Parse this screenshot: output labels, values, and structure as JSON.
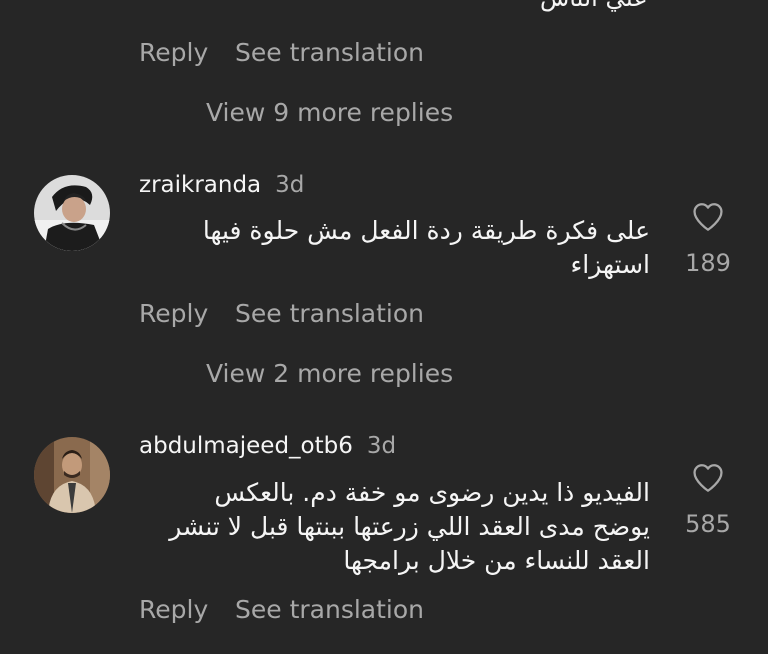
{
  "top": {
    "cut_text": "علي الناس",
    "reply_label": "Reply",
    "translate_label": "See translation",
    "view_more": "View 9 more replies"
  },
  "comments": [
    {
      "username": "zraikranda",
      "time": "3d",
      "lines": [
        "على فكرة طريقة ردة الفعل مش حلوة  فيها",
        "استهزاء"
      ],
      "likes": "189",
      "reply_label": "Reply",
      "translate_label": "See translation",
      "view_more": "View 2 more replies"
    },
    {
      "username": "abdulmajeed_otb6",
      "time": "3d",
      "lines": [
        "الفيديو ذا يدين رضوى مو خفة دم.  بالعكس",
        "يوضح مدى العقد اللي زرعتها ببنتها قبل لا تنشر",
        "العقد للنساء من خلال برامجها"
      ],
      "likes": "585",
      "reply_label": "Reply",
      "translate_label": "See translation"
    }
  ],
  "icons": {
    "like": "heart-outline-icon"
  },
  "colors": {
    "background": "#262626",
    "primary_text": "#f5f5f5",
    "secondary_text": "#a8a8a8"
  }
}
